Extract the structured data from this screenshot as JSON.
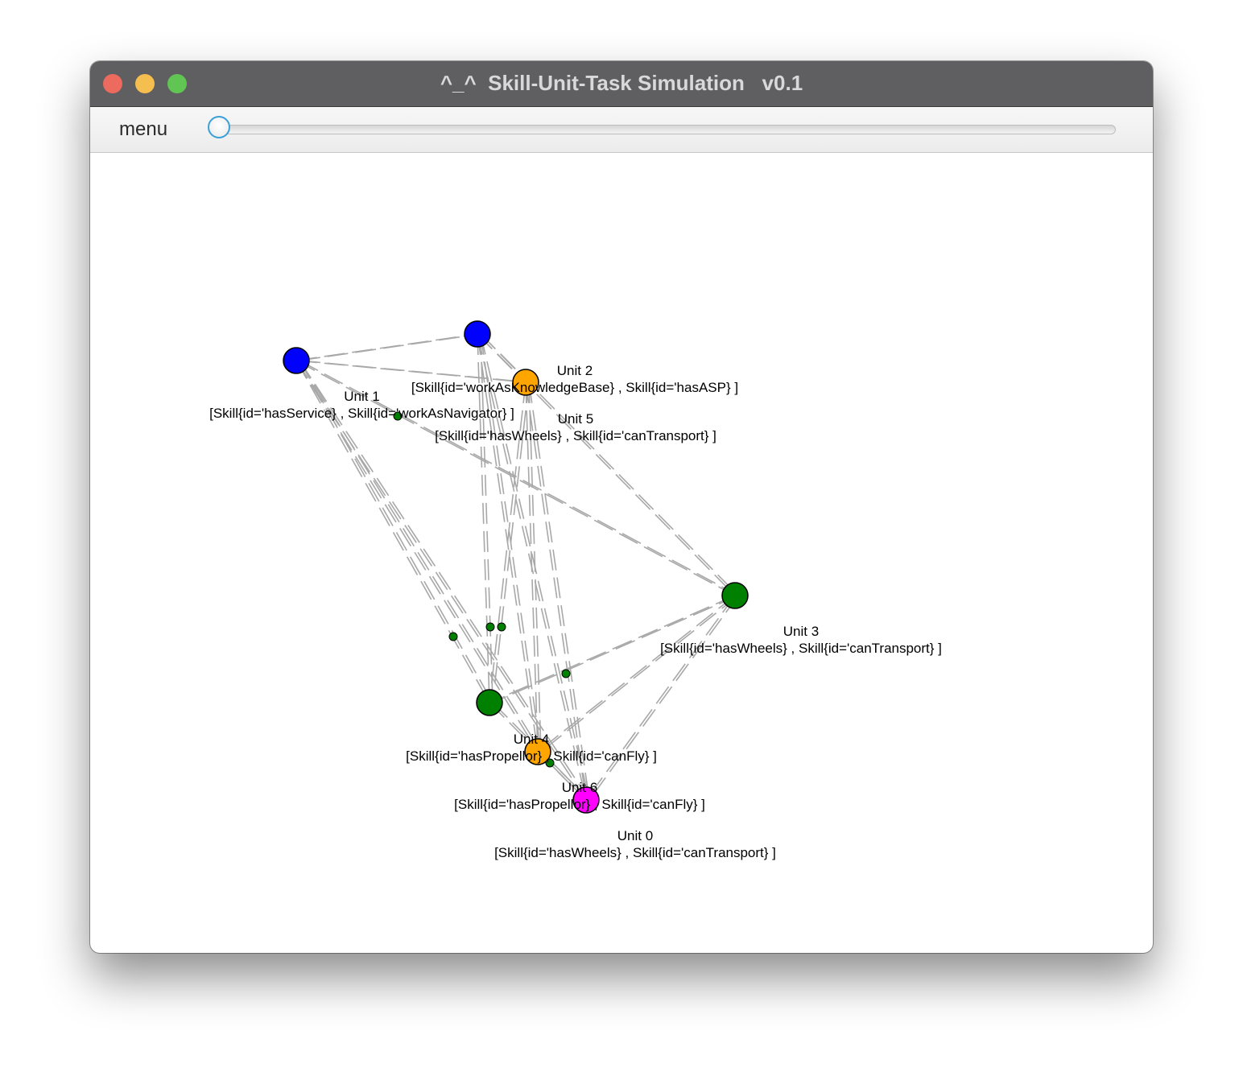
{
  "window": {
    "title": "^_^  Skill-Unit-Task Simulation   v0.1"
  },
  "toolbar": {
    "menu_label": "menu",
    "slider_value": 0
  },
  "graph": {
    "units": [
      {
        "name": "Unit 0",
        "skills": "[Skill{id='hasWheels} , Skill{id='canTransport} ]"
      },
      {
        "name": "Unit 1",
        "skills": "[Skill{id='hasService} , Skill{id='workAsNavigator} ]"
      },
      {
        "name": "Unit 2",
        "skills": "[Skill{id='workAsKnowledgeBase} , Skill{id='hasASP} ]"
      },
      {
        "name": "Unit 3",
        "skills": "[Skill{id='hasWheels} , Skill{id='canTransport} ]"
      },
      {
        "name": "Unit 4",
        "skills": "[Skill{id='hasPropellor} , Skill{id='canFly} ]"
      },
      {
        "name": "Unit 5",
        "skills": "[Skill{id='hasWheels} , Skill{id='canTransport} ]"
      },
      {
        "name": "Unit 6",
        "skills": "[Skill{id='hasPropellor} , Skill{id='canFly} ]"
      }
    ],
    "colors": {
      "blue": "#0000ff",
      "orange": "#ffa500",
      "green": "#008000",
      "magenta": "#ff00ff",
      "edge": "#a8a8a8"
    }
  }
}
